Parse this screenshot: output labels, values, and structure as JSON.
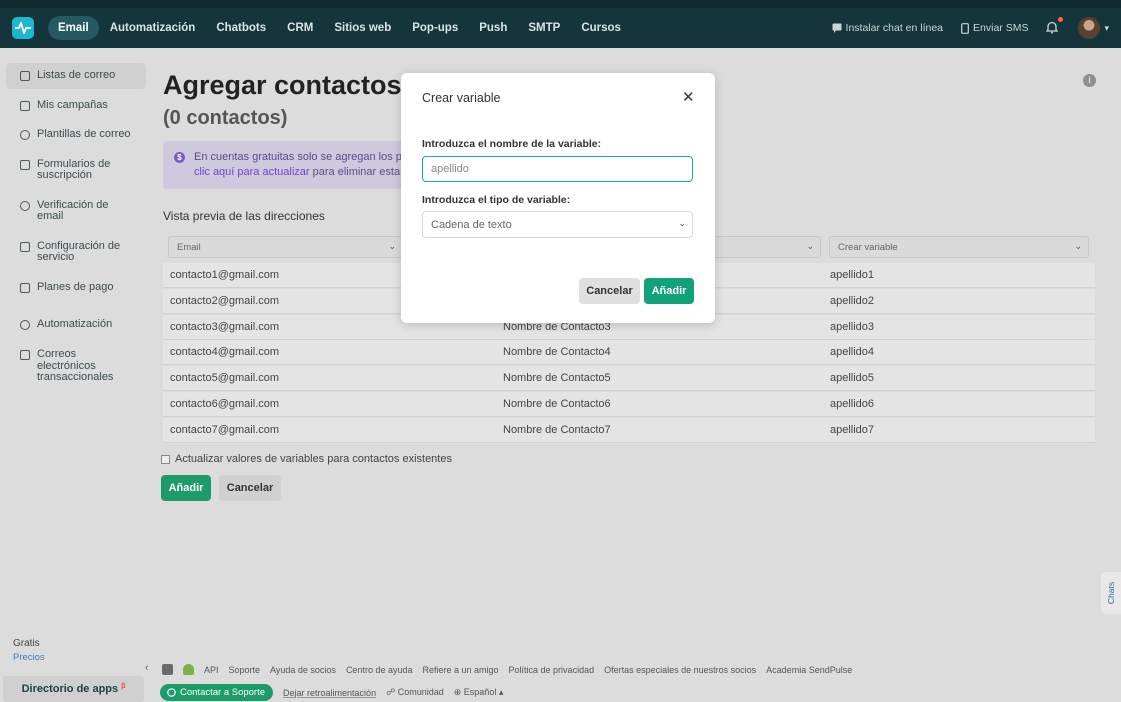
{
  "nav": {
    "items": [
      "Email",
      "Automatización",
      "Chatbots",
      "CRM",
      "Sitios web",
      "Pop-ups",
      "Push",
      "SMTP",
      "Cursos"
    ],
    "active": "Email",
    "install_chat": "Instalar chat en línea",
    "send_sms": "Enviar SMS"
  },
  "sidebar": {
    "items": [
      {
        "label": "Listas de correo",
        "icon": "list-icon"
      },
      {
        "label": "Mis campañas",
        "icon": "campaign-icon"
      },
      {
        "label": "Plantillas de correo",
        "icon": "template-icon"
      },
      {
        "label": "Formularios de suscripción",
        "icon": "form-icon"
      },
      {
        "label": "Verificación de email",
        "icon": "verify-icon"
      },
      {
        "label": "Configuración de servicio",
        "icon": "settings-icon"
      },
      {
        "label": "Planes de pago",
        "icon": "billing-icon"
      },
      {
        "label": "Automatización",
        "icon": "automation-icon"
      },
      {
        "label": "Correos electrónicos transaccionales",
        "icon": "transactional-icon"
      }
    ],
    "plan": "Gratis",
    "prices": "Precios",
    "apps_directory": "Directorio de apps",
    "apps_badge": "β"
  },
  "main": {
    "title": "Agregar contactos:",
    "subtitle": "(0 contactos)",
    "notice_text": "En cuentas gratuitas solo se agregan los p",
    "notice_link": "clic aquí para actualizar",
    "notice_rest": "para eliminar esta",
    "preview_title": "Vista previa de las direcciones",
    "columns": [
      "Email",
      "",
      "Crear variable"
    ],
    "rows": [
      {
        "email": "contacto1@gmail.com",
        "name": "",
        "var": "apellido1"
      },
      {
        "email": "contacto2@gmail.com",
        "name": "",
        "var": "apellido2"
      },
      {
        "email": "contacto3@gmail.com",
        "name": "Nombre de Contacto3",
        "var": "apellido3"
      },
      {
        "email": "contacto4@gmail.com",
        "name": "Nombre de Contacto4",
        "var": "apellido4"
      },
      {
        "email": "contacto5@gmail.com",
        "name": "Nombre de Contacto5",
        "var": "apellido5"
      },
      {
        "email": "contacto6@gmail.com",
        "name": "Nombre de Contacto6",
        "var": "apellido6"
      },
      {
        "email": "contacto7@gmail.com",
        "name": "Nombre de Contacto7",
        "var": "apellido7"
      }
    ],
    "update_checkbox": "Actualizar valores de variables para contactos existentes",
    "add_button": "Añadir",
    "cancel_button": "Cancelar",
    "chats_tab": "Chats"
  },
  "footer": {
    "links": [
      "API",
      "Soporte",
      "Ayuda de socios",
      "Centro de ayuda",
      "Refiere a un amigo",
      "Política de privacidad",
      "Ofertas especiales de nuestros socios",
      "Academia SendPulse"
    ],
    "contact_support": "Contactar a Soporte",
    "feedback": "Dejar retroalimentación",
    "community": "Comunidad",
    "language": "Español"
  },
  "modal": {
    "title": "Crear variable",
    "name_label": "Introduzca el nombre de la variable:",
    "name_value": "apellido",
    "type_label": "Introduzca el tipo de variable:",
    "type_value": "Cadena de texto",
    "cancel": "Cancelar",
    "add": "Añadir"
  }
}
